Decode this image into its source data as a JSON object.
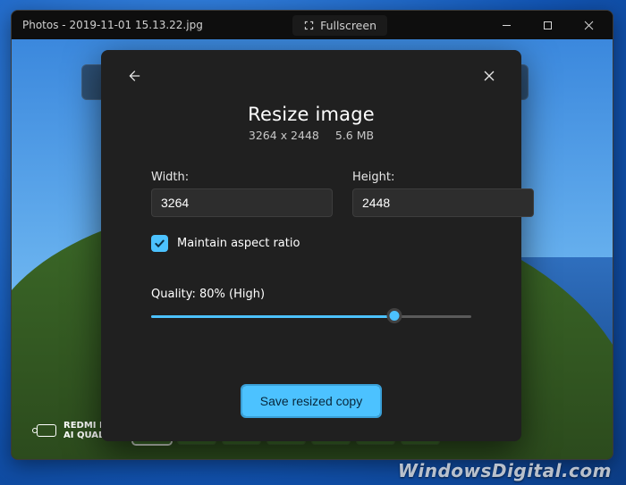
{
  "window": {
    "title": "Photos - 2019-11-01 15.13.22.jpg",
    "fullscreen_label": "Fullscreen"
  },
  "dialog": {
    "title": "Resize image",
    "original_dimensions": "3264 x 2448",
    "file_size": "5.6 MB",
    "width_label": "Width:",
    "height_label": "Height:",
    "width_value": "3264",
    "height_value": "2448",
    "aspect_label": "Maintain aspect ratio",
    "aspect_checked": true,
    "quality_label": "Quality: 80% (High)",
    "quality_percent": 80,
    "save_label": "Save resized copy"
  },
  "camera_badge": {
    "line1": "REDMI NOT",
    "line2": "AI QUAD CA"
  },
  "watermark": "WindowsDigital.com"
}
